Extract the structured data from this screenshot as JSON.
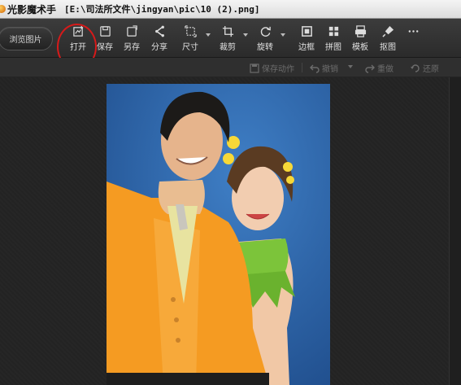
{
  "window": {
    "app_name": "光影魔术手",
    "file_path": "[E:\\司法所文件\\jingyan\\pic\\10 (2).png]"
  },
  "toolbar": {
    "browse_label": "浏览图片",
    "tools": [
      {
        "label": "打开",
        "icon": "open-icon"
      },
      {
        "label": "保存",
        "icon": "save-icon"
      },
      {
        "label": "另存",
        "icon": "save-as-icon"
      },
      {
        "label": "分享",
        "icon": "share-icon"
      },
      {
        "label": "尺寸",
        "icon": "resize-icon"
      },
      {
        "label": "裁剪",
        "icon": "crop-icon"
      },
      {
        "label": "旋转",
        "icon": "rotate-icon"
      },
      {
        "label": "边框",
        "icon": "border-icon"
      },
      {
        "label": "拼图",
        "icon": "collage-icon"
      },
      {
        "label": "模板",
        "icon": "template-icon"
      },
      {
        "label": "抠图",
        "icon": "cutout-icon"
      },
      {
        "label": "",
        "icon": "more-icon"
      }
    ]
  },
  "subbar": {
    "save_action": "保存动作",
    "undo": "撤销",
    "redo": "重做",
    "restore": "还原"
  },
  "colors": {
    "highlight": "#d71a1a",
    "photo_background": "#2c62a6",
    "jacket": "#f59b22",
    "dress": "#7cc43a"
  }
}
